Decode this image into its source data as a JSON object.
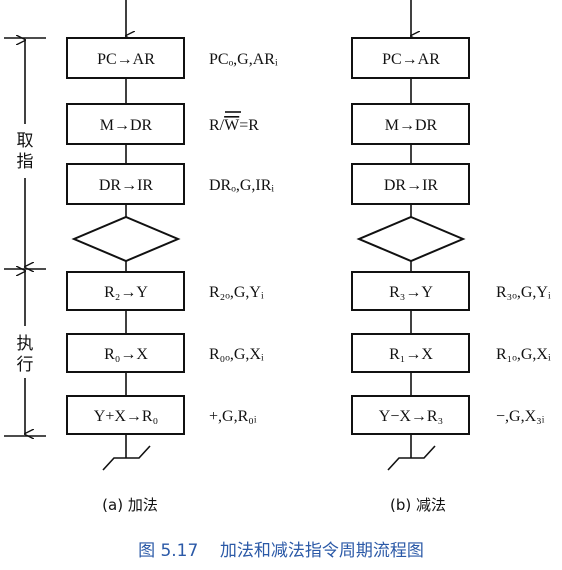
{
  "left": {
    "steps": [
      {
        "box": "PC→AR",
        "signal": "PCₒ,G,ARᵢ"
      },
      {
        "box": "M→DR",
        "signal": "R/W=R"
      },
      {
        "box": "DR→IR",
        "signal": "DRₒ,G,IRᵢ"
      },
      {
        "box": "R₂→Y",
        "signal": "R₂ₒ,G,Yᵢ"
      },
      {
        "box": "R₀→X",
        "signal": "R₀ₒ,G,Xᵢ"
      },
      {
        "box": "Y+X→R₀",
        "signal": "+,G,R₀ᵢ"
      }
    ],
    "label": "(a) 加法"
  },
  "right": {
    "steps": [
      {
        "box": "PC→AR",
        "signal": ""
      },
      {
        "box": "M→DR",
        "signal": ""
      },
      {
        "box": "DR→IR",
        "signal": ""
      },
      {
        "box": "R₃→Y",
        "signal": "R₃ₒ,G,Yᵢ"
      },
      {
        "box": "R₁→X",
        "signal": "R₁ₒ,G,Xᵢ"
      },
      {
        "box": "Y−X→R₃",
        "signal": "−,G,X₃ᵢ"
      }
    ],
    "label": "(b) 减法"
  },
  "phases": {
    "fetch": "取指",
    "execute": "执行"
  },
  "caption": "图 5.17    加法和减法指令周期流程图"
}
